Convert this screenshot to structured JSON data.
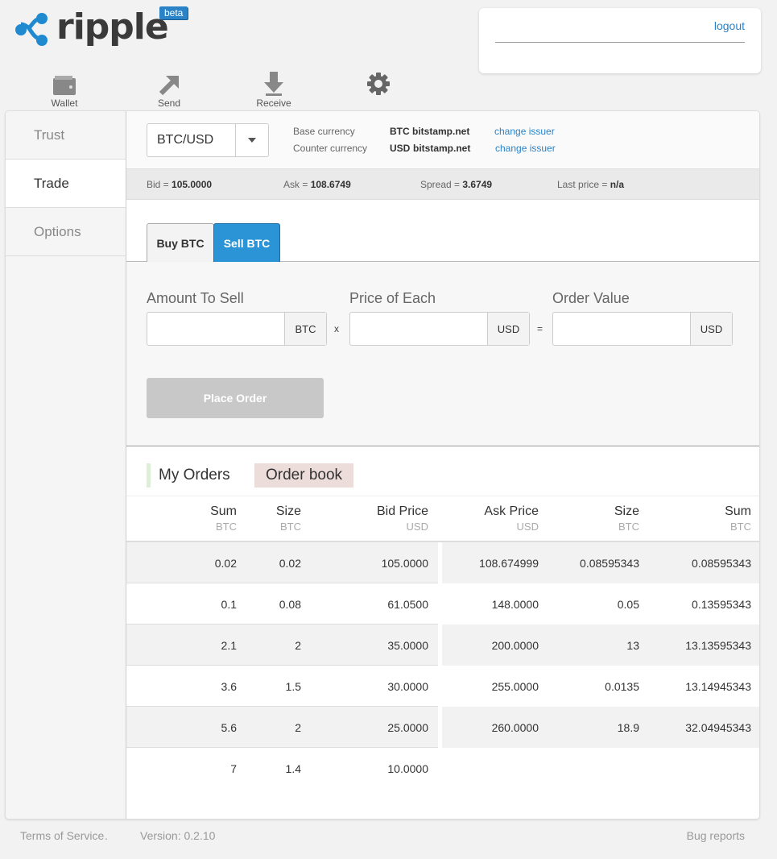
{
  "brand": {
    "name": "ripple",
    "badge": "beta"
  },
  "user": {
    "logout_label": "logout"
  },
  "nav": [
    {
      "label": "Wallet",
      "icon": "wallet-icon"
    },
    {
      "label": "Send",
      "icon": "send-arrow-icon"
    },
    {
      "label": "Receive",
      "icon": "receive-arrow-icon"
    },
    {
      "label": "",
      "icon": "gear-icon"
    }
  ],
  "sidebar": {
    "items": [
      {
        "label": "Trust"
      },
      {
        "label": "Trade"
      },
      {
        "label": "Options"
      }
    ],
    "active": "Trade"
  },
  "pair": {
    "selected": "BTC/USD",
    "base_label": "Base currency",
    "base_code": "BTC",
    "base_issuer": "bitstamp.net",
    "counter_label": "Counter currency",
    "counter_code": "USD",
    "counter_issuer": "bitstamp.net",
    "change_issuer": "change issuer"
  },
  "ticker": {
    "bid_label": "Bid = ",
    "bid": "105.0000",
    "ask_label": "Ask = ",
    "ask": "108.6749",
    "spread_label": "Spread = ",
    "spread": "3.6749",
    "last_label": "Last price = ",
    "last": "n/a"
  },
  "tabs": {
    "buy": "Buy BTC",
    "sell": "Sell BTC",
    "active": "sell"
  },
  "form": {
    "amount_label": "Amount To Sell",
    "amount_unit": "BTC",
    "amount_value": "",
    "price_label": "Price of Each",
    "price_unit": "USD",
    "price_value": "",
    "value_label": "Order Value",
    "value_unit": "USD",
    "value_value": "",
    "times": "x",
    "equals": "=",
    "place_order": "Place Order"
  },
  "orders": {
    "my_orders": "My Orders",
    "order_book": "Order book"
  },
  "table": {
    "headers": [
      {
        "h": "Sum",
        "u": "BTC"
      },
      {
        "h": "Size",
        "u": "BTC"
      },
      {
        "h": "Bid Price",
        "u": "USD"
      },
      {
        "h": "Ask Price",
        "u": "USD"
      },
      {
        "h": "Size",
        "u": "BTC"
      },
      {
        "h": "Sum",
        "u": "BTC"
      }
    ],
    "bids": [
      {
        "sum": "0.02",
        "size": "0.02",
        "price": "105.0000"
      },
      {
        "sum": "0.1",
        "size": "0.08",
        "price": "61.0500"
      },
      {
        "sum": "2.1",
        "size": "2",
        "price": "35.0000"
      },
      {
        "sum": "3.6",
        "size": "1.5",
        "price": "30.0000"
      },
      {
        "sum": "5.6",
        "size": "2",
        "price": "25.0000"
      },
      {
        "sum": "7",
        "size": "1.4",
        "price": "10.0000"
      }
    ],
    "asks": [
      {
        "price": "108.674999",
        "size": "0.08595343",
        "sum": "0.08595343"
      },
      {
        "price": "148.0000",
        "size": "0.05",
        "sum": "0.13595343"
      },
      {
        "price": "200.0000",
        "size": "13",
        "sum": "13.13595343"
      },
      {
        "price": "255.0000",
        "size": "0.0135",
        "sum": "13.14945343"
      },
      {
        "price": "260.0000",
        "size": "18.9",
        "sum": "32.04945343"
      }
    ]
  },
  "footer": {
    "terms": "Terms of Service",
    "version": "Version: 0.2.10",
    "bugs": "Bug reports"
  },
  "colors": {
    "accent": "#2b83c7",
    "sell_tab": "#2a94d6",
    "logo_blue": "#1f8ad0"
  }
}
